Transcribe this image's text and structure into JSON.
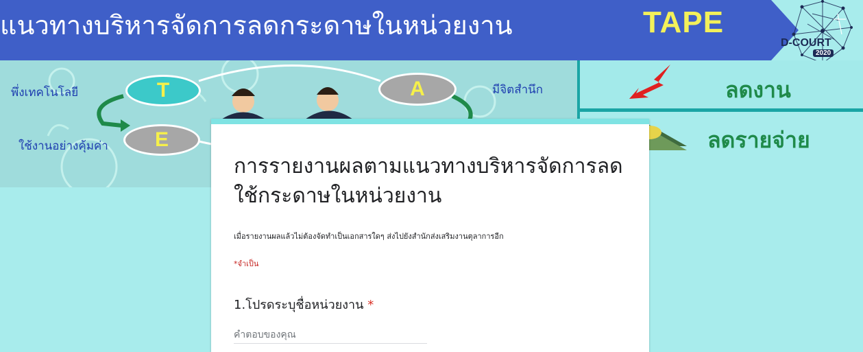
{
  "banner": {
    "title": "แนวทางบริหารจัดการลดกระดาษในหน่วยงาน",
    "tape_word": "TAPE",
    "logo_text": "D-COURT",
    "logo_year": "2020",
    "letters": {
      "t": "T",
      "a": "A",
      "e": "E"
    },
    "labels": {
      "technology": "พึ่งเทคโนโลยี",
      "awareness": "มีจิตสำนึก",
      "efficient": "ใช้งานอย่างคุ้มค่า"
    },
    "reduce_work": "ลดงาน",
    "reduce_cost": "ลดรายจ่าย",
    "colors": {
      "title_bar": "#3f5fc8",
      "tape": "#f3f05a",
      "teal": "#a8ecec",
      "green_text": "#1f8a4a"
    }
  },
  "form": {
    "title": "การรายงานผลตามแนวทางบริหารจัดการลดใช้กระดาษในหน่วยงาน",
    "description": "เมื่อรายงานผลแล้วไม่ต้องจัดทำเป็นเอกสารใดๆ ส่งไปยังสำนักส่งเสริมงานตุลาการอีก",
    "required_note": "*จำเป็น",
    "question1": {
      "label": "1.โปรดระบุชื่อหน่วยงาน",
      "required_mark": "*",
      "placeholder": "คำตอบของคุณ"
    }
  }
}
